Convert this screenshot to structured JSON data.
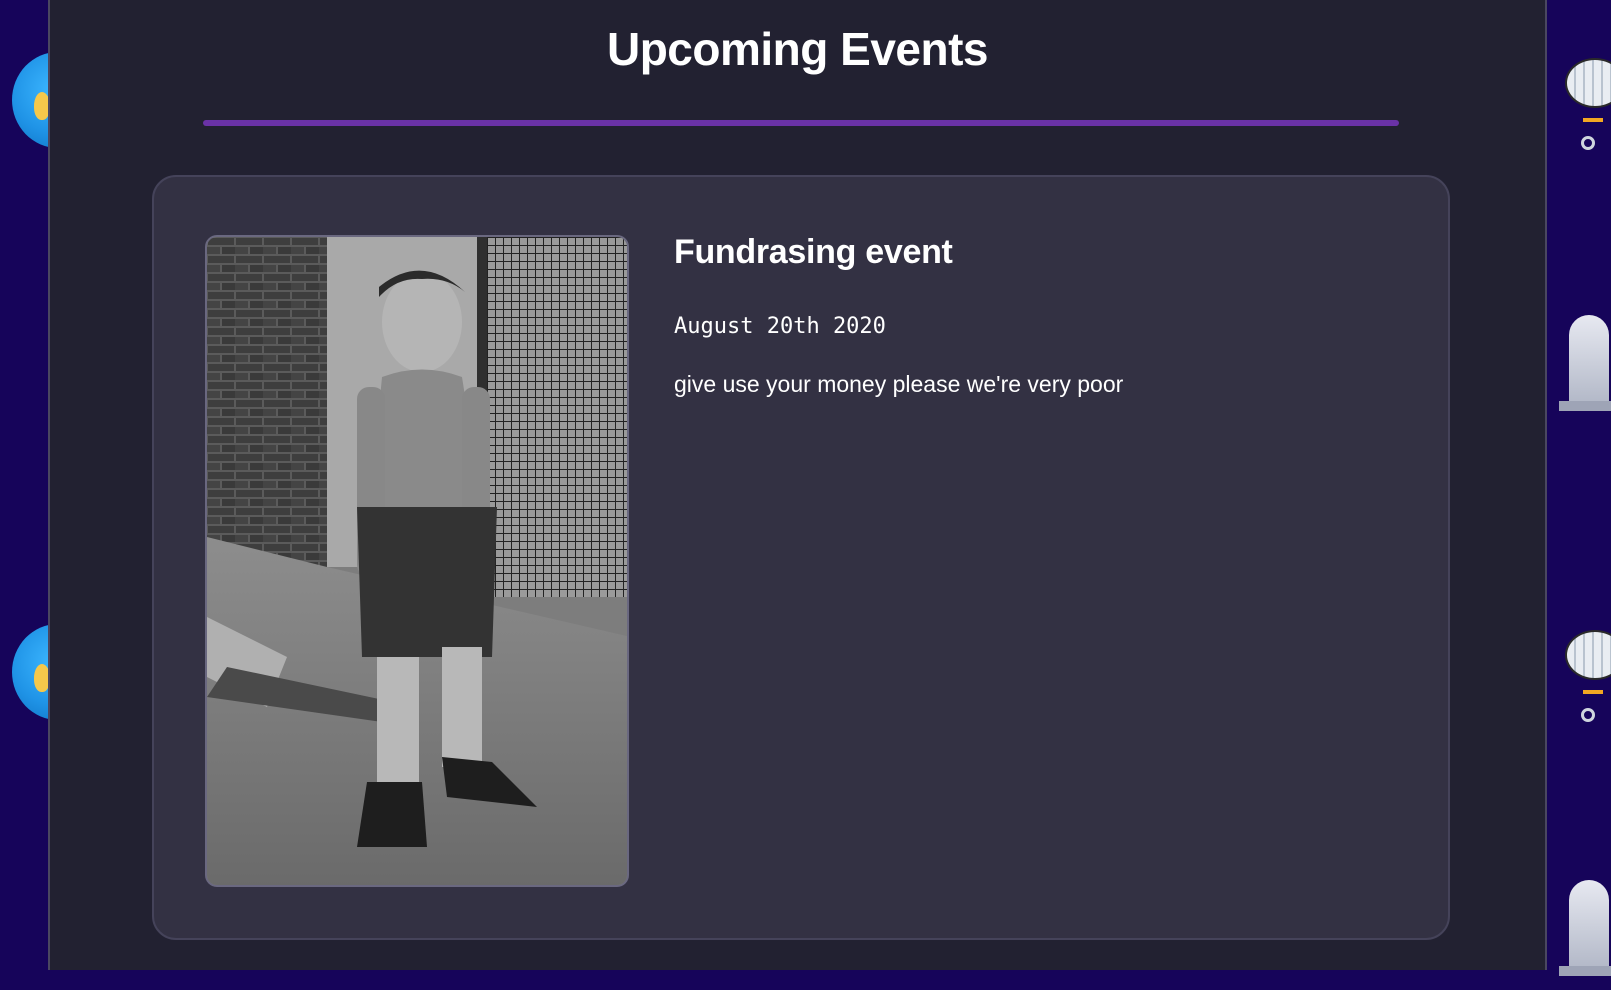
{
  "page": {
    "title": "Upcoming Events"
  },
  "events": [
    {
      "title": "Fundrasing event",
      "date": "August 20th 2020",
      "description": "give use your money please we're very poor"
    }
  ],
  "colors": {
    "page_background": "#16045a",
    "column_background": "#222131",
    "card_background": "#333143",
    "divider_accent": "#6a32a6",
    "text": "#ffffff"
  },
  "icons": {
    "left_decoration": "globe-icon",
    "right_decoration_1": "hot-air-balloon-icon",
    "right_decoration_2": "rocket-icon"
  }
}
